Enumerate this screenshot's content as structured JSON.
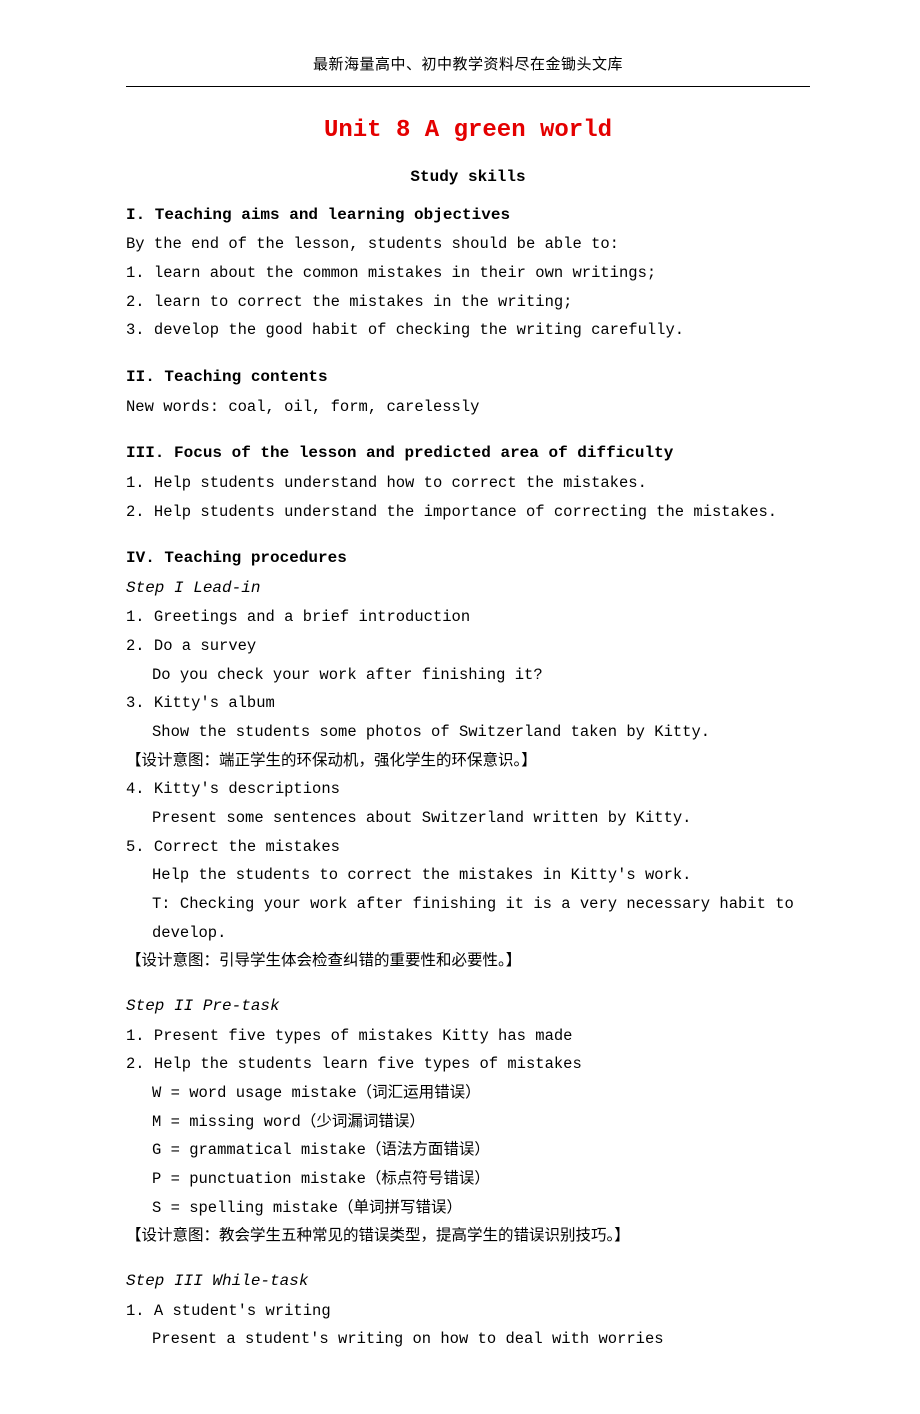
{
  "header": "最新海量高中、初中教学资料尽在金锄头文库",
  "title": "Unit 8 A green world",
  "subtitle": "Study skills",
  "s1": {
    "head": "I. Teaching aims and learning objectives",
    "intro": "By the end of the lesson, students should be able to:",
    "p1": "1. learn about the common mistakes in their own writings;",
    "p2": "2. learn to correct the mistakes in the writing;",
    "p3": "3. develop the good habit of checking the writing carefully."
  },
  "s2": {
    "head": "II. Teaching contents",
    "p1": "New words: coal, oil, form, carelessly"
  },
  "s3": {
    "head": "III. Focus of the lesson and predicted area of difficulty",
    "p1": "1. Help students understand how to correct the mistakes.",
    "p2": "2. Help students understand the importance of correcting the mistakes."
  },
  "s4": {
    "head": "IV. Teaching procedures",
    "step1": {
      "title": "Step I Lead-in",
      "p1": "1. Greetings and a brief introduction",
      "p2": "2. Do a survey",
      "p2a": "Do you check your work after finishing it?",
      "p3": "3. Kitty's album",
      "p3a": "Show the students some photos of Switzerland taken by Kitty.",
      "n1": "【设计意图：端正学生的环保动机，强化学生的环保意识。】",
      "p4": "4. Kitty's descriptions",
      "p4a": "Present some sentences about Switzerland written by Kitty.",
      "p5": "5. Correct the mistakes",
      "p5a": "Help the students to correct the mistakes in Kitty's work.",
      "p5b": "T: Checking your work after finishing it is a very necessary habit to develop.",
      "n2": "【设计意图：引导学生体会检查纠错的重要性和必要性。】"
    },
    "step2": {
      "title": "Step II Pre-task",
      "p1": "1. Present five types of mistakes Kitty has made",
      "p2": "2. Help the students learn five types of mistakes",
      "t1": "W = word usage mistake（词汇运用错误）",
      "t2": "M = missing word（少词漏词错误）",
      "t3": "G = grammatical mistake（语法方面错误）",
      "t4": "P = punctuation mistake（标点符号错误）",
      "t5": "S = spelling mistake（单词拼写错误）",
      "n1": "【设计意图：教会学生五种常见的错误类型，提高学生的错误识别技巧。】"
    },
    "step3": {
      "title": "Step III While-task",
      "p1": "1. A student's writing",
      "p1a": "Present a student's writing on how to deal with worries"
    }
  }
}
